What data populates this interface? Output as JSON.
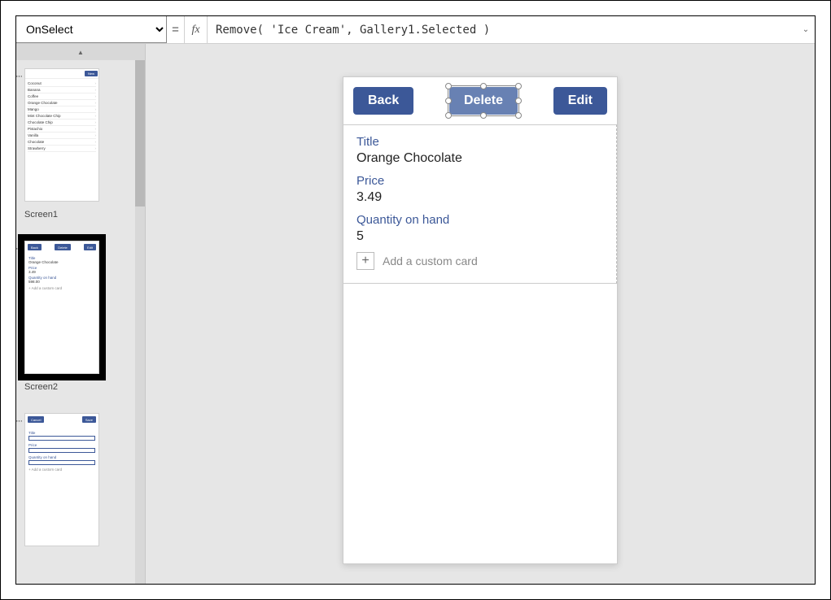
{
  "formula_bar": {
    "property": "OnSelect",
    "formula": "Remove( 'Ice Cream', Gallery1.Selected )"
  },
  "screens": {
    "s1": {
      "label": "Screen1"
    },
    "s2": {
      "label": "Screen2"
    }
  },
  "thumb1": {
    "new_btn": "New",
    "items": [
      "Coconut",
      "Banana",
      "Coffee",
      "Orange Chocolate",
      "Mango",
      "Mint Chocolate Chip",
      "Chocolate Chip",
      "Pistachio",
      "Vanilla",
      "Chocolate",
      "Strawberry"
    ]
  },
  "thumb2": {
    "back": "Back",
    "delete": "Delete",
    "edit": "Edit",
    "title_lbl": "Title",
    "title_val": "Orange Chocolate",
    "price_lbl": "Price",
    "price_val": "3.49",
    "qty_lbl": "Quantity on hand",
    "qty_val": "598.00",
    "add": "+   Add a custom card"
  },
  "thumb3": {
    "cancel": "Cancel",
    "save": "Save",
    "title_lbl": "Title",
    "price_lbl": "Price",
    "qty_lbl": "Quantity on hand",
    "add": "+   Add a custom card"
  },
  "canvas": {
    "back": "Back",
    "delete": "Delete",
    "edit": "Edit",
    "title_lbl": "Title",
    "title_val": "Orange Chocolate",
    "price_lbl": "Price",
    "price_val": "3.49",
    "qty_lbl": "Quantity on hand",
    "qty_val": "5",
    "plus": "+",
    "add_text": "Add a custom card"
  }
}
